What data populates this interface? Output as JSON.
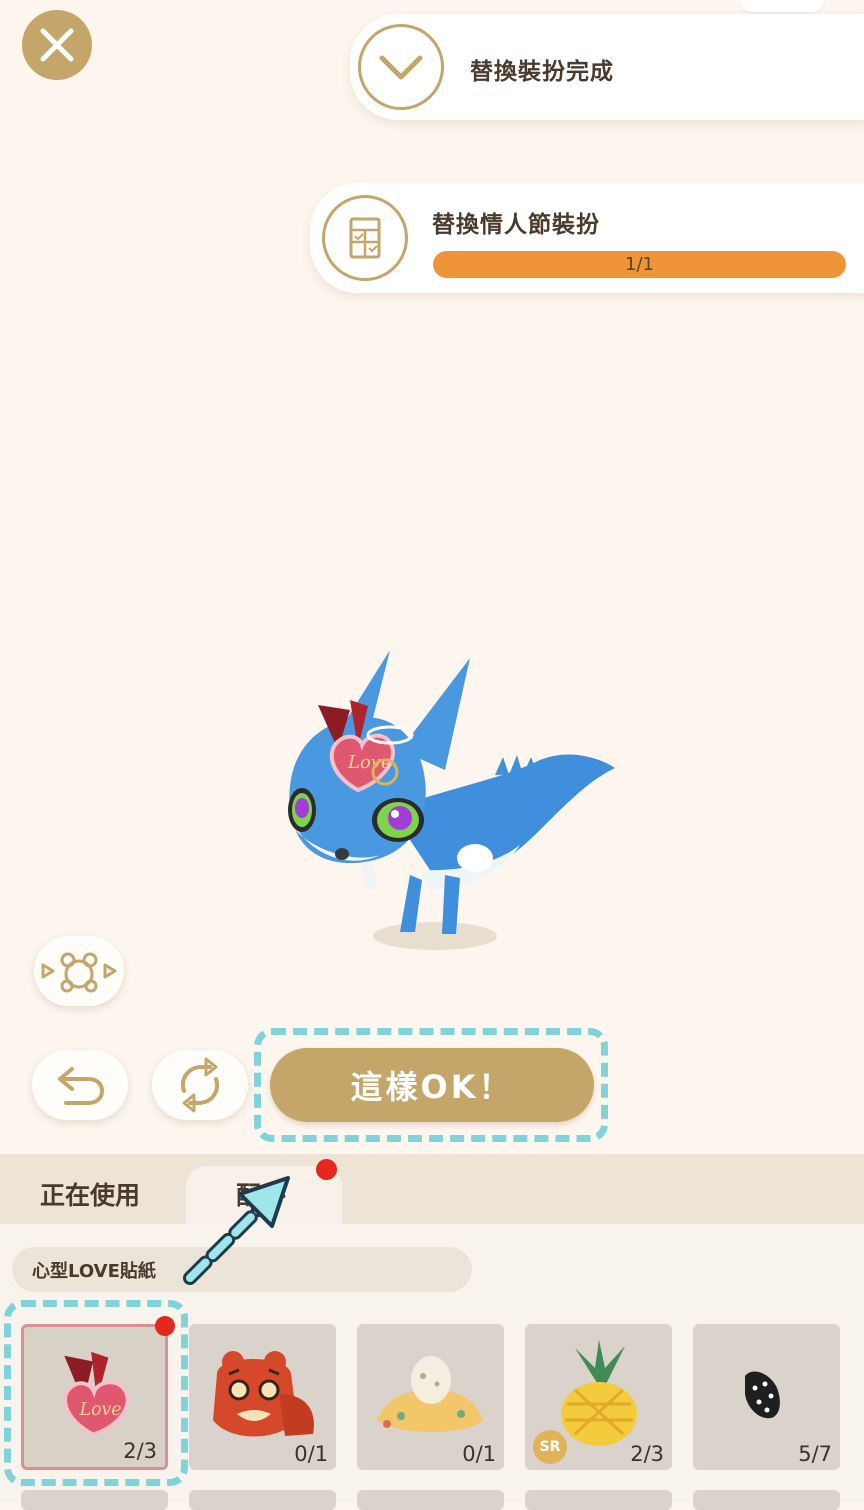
{
  "toasts": {
    "complete_title": "替換裝扮完成",
    "mission_title": "替換情人節裝扮",
    "mission_progress_text": "1/1",
    "mission_progress_fraction": 1.0
  },
  "confirm_button": {
    "label": "這樣OK！"
  },
  "tabs": [
    {
      "label": "正在使用"
    },
    {
      "label": "配件"
    }
  ],
  "selected_item": {
    "name": "心型LOVE貼紙"
  },
  "items": [
    {
      "icon": "love-heart-sticker-icon",
      "count": "2/3",
      "selected": true,
      "new": true
    },
    {
      "icon": "tiger-mask-icon",
      "count": "0/1"
    },
    {
      "icon": "egg-nest-icon",
      "count": "0/1"
    },
    {
      "icon": "pineapple-hat-icon",
      "count": "2/3",
      "badge": "SR"
    },
    {
      "icon": "black-stud-icon",
      "count": "5/7"
    }
  ],
  "colors": {
    "background": "#fdf6ee",
    "accent_gold": "#c4a66b",
    "progress_orange": "#f0943a",
    "tutorial_cyan": "#7fd3d9",
    "notification_red": "#e5281e"
  }
}
